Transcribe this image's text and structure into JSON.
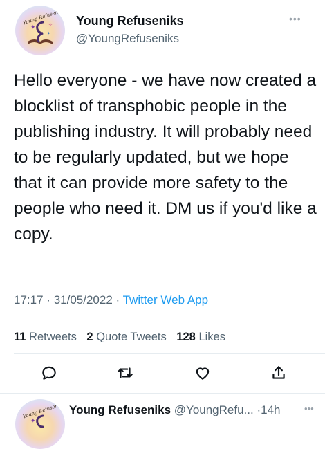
{
  "author": {
    "avatar_text": "Young Refuseniks",
    "display_name": "Young Refuseniks",
    "handle": "@YoungRefuseniks"
  },
  "more_icon": "more-horizontal-icon",
  "tweet": {
    "text": "Hello everyone - we have now created a blocklist of transphobic people in the publishing industry. It will probably need to be regularly updated, but we hope that it can provide more safety to the people who need it. DM us if you'd like a copy.",
    "time": "17:17",
    "date": "31/05/2022",
    "source": "Twitter Web App",
    "separator": "·"
  },
  "stats": {
    "retweets_count": "11",
    "retweets_label": "Retweets",
    "quotes_count": "2",
    "quotes_label": "Quote Tweets",
    "likes_count": "128",
    "likes_label": "Likes"
  },
  "actions": [
    {
      "icon": "reply-icon"
    },
    {
      "icon": "retweet-icon"
    },
    {
      "icon": "like-icon"
    },
    {
      "icon": "share-icon"
    }
  ],
  "next_tweet": {
    "avatar_text": "Young Refuseniks",
    "display_name": "Young Refuseniks",
    "handle": "@YoungRefu...",
    "separator": "·",
    "age": "14h"
  },
  "colors": {
    "accent": "#1d9bf0",
    "secondary_text": "#536471",
    "primary_text": "#0f1419"
  }
}
